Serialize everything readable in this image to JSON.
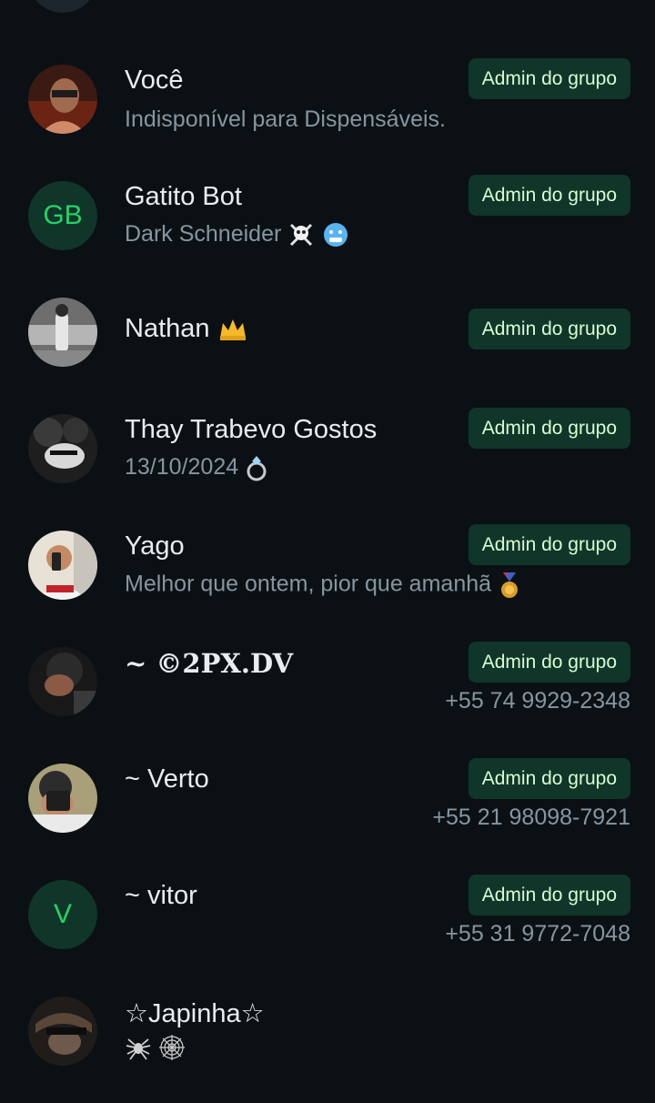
{
  "badge_label": "Admin do grupo",
  "members": [
    {
      "name": "Você",
      "status": "Indisponível para Dispensáveis.",
      "phone": "",
      "admin": true,
      "avatar": "photo",
      "avatar_icon": "person-photo-icon"
    },
    {
      "name": "Gatito Bot",
      "status": "Dark Schneider ",
      "phone": "",
      "admin": true,
      "avatar": "initials",
      "initials": "GB",
      "emoji_status": [
        "skull-crossbones-icon",
        "cold-face-icon"
      ]
    },
    {
      "name": "Nathan",
      "status": "",
      "phone": "",
      "admin": true,
      "avatar": "photo",
      "avatar_icon": "person-photo-icon",
      "emoji_name": [
        "crown-icon"
      ]
    },
    {
      "name": "Thay Trabevo Gostos",
      "status": "13/10/2024",
      "phone": "",
      "admin": true,
      "avatar": "photo",
      "avatar_icon": "person-photo-icon",
      "emoji_status": [
        "ring-icon"
      ]
    },
    {
      "name": "Yago",
      "status": "Melhor que ontem, pior que amanhã ",
      "phone": "",
      "admin": true,
      "avatar": "photo",
      "avatar_icon": "person-photo-icon",
      "emoji_status": [
        "medal-icon"
      ]
    },
    {
      "name": "~ ©2PX.DV",
      "status": "",
      "phone": "+55 74 9929-2348",
      "admin": true,
      "avatar": "photo",
      "avatar_icon": "person-photo-icon"
    },
    {
      "name": "~ Verto",
      "status": "",
      "phone": "+55 21 98098-7921",
      "admin": true,
      "avatar": "photo",
      "avatar_icon": "person-photo-icon"
    },
    {
      "name": "~ vitor",
      "status": "",
      "phone": "+55 31 9772-7048",
      "admin": true,
      "avatar": "initials",
      "initials": "V"
    },
    {
      "name": "☆Japinha☆",
      "status": "",
      "phone": "",
      "admin": false,
      "avatar": "photo",
      "avatar_icon": "person-photo-icon",
      "emoji_status": [
        "spider-icon",
        "spider-web-icon"
      ]
    }
  ],
  "colors": {
    "background": "#0b1014",
    "primary_text": "#e9edef",
    "secondary_text": "#8696a0",
    "badge_bg": "#103529",
    "badge_text": "#d9fdd3",
    "accent_green": "#25d366"
  }
}
